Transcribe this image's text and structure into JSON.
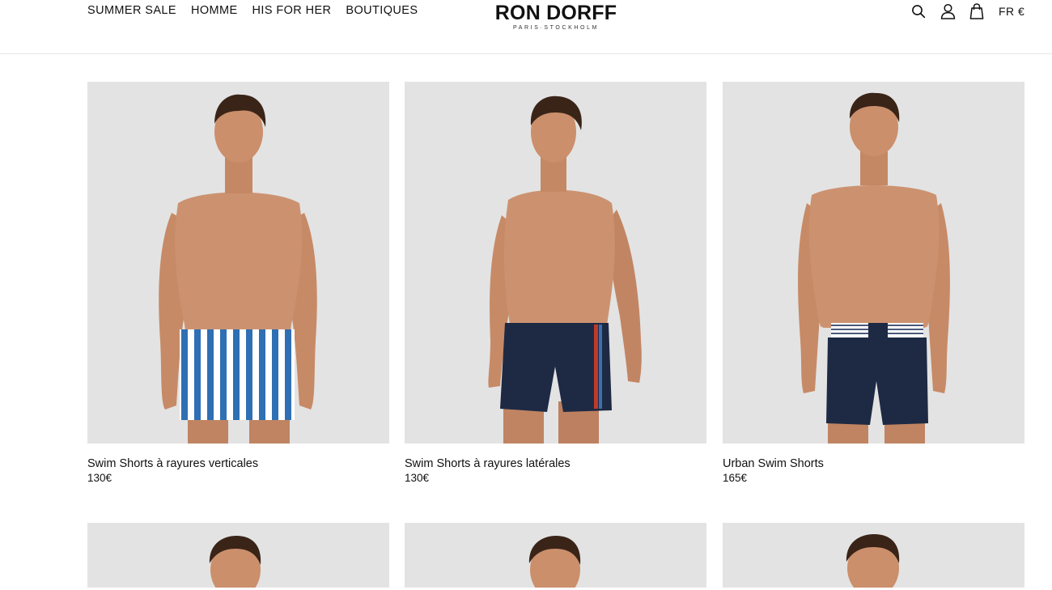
{
  "nav": {
    "items": [
      {
        "label": "SUMMER SALE"
      },
      {
        "label": "HOMME"
      },
      {
        "label": "HIS FOR HER"
      },
      {
        "label": "BOUTIQUES"
      }
    ]
  },
  "brand": {
    "name": "RON DORFF",
    "tagline": "PARIS·STOCKHOLM"
  },
  "tools": {
    "search_icon": "search-icon",
    "account_icon": "user-icon",
    "cart_icon": "shopping-bag-icon",
    "locale": "FR €"
  },
  "colors": {
    "photo_bg": "#e3e3e3",
    "skin": "#c9906a",
    "hair": "#3a2418",
    "navy": "#1e2a44",
    "stripe_blue": "#2f6fb3"
  },
  "products": [
    {
      "name": "Swim Shorts à rayures verticales",
      "price": "130€"
    },
    {
      "name": "Swim Shorts à rayures latérales",
      "price": "130€"
    },
    {
      "name": "Urban Swim Shorts",
      "price": "165€"
    }
  ]
}
